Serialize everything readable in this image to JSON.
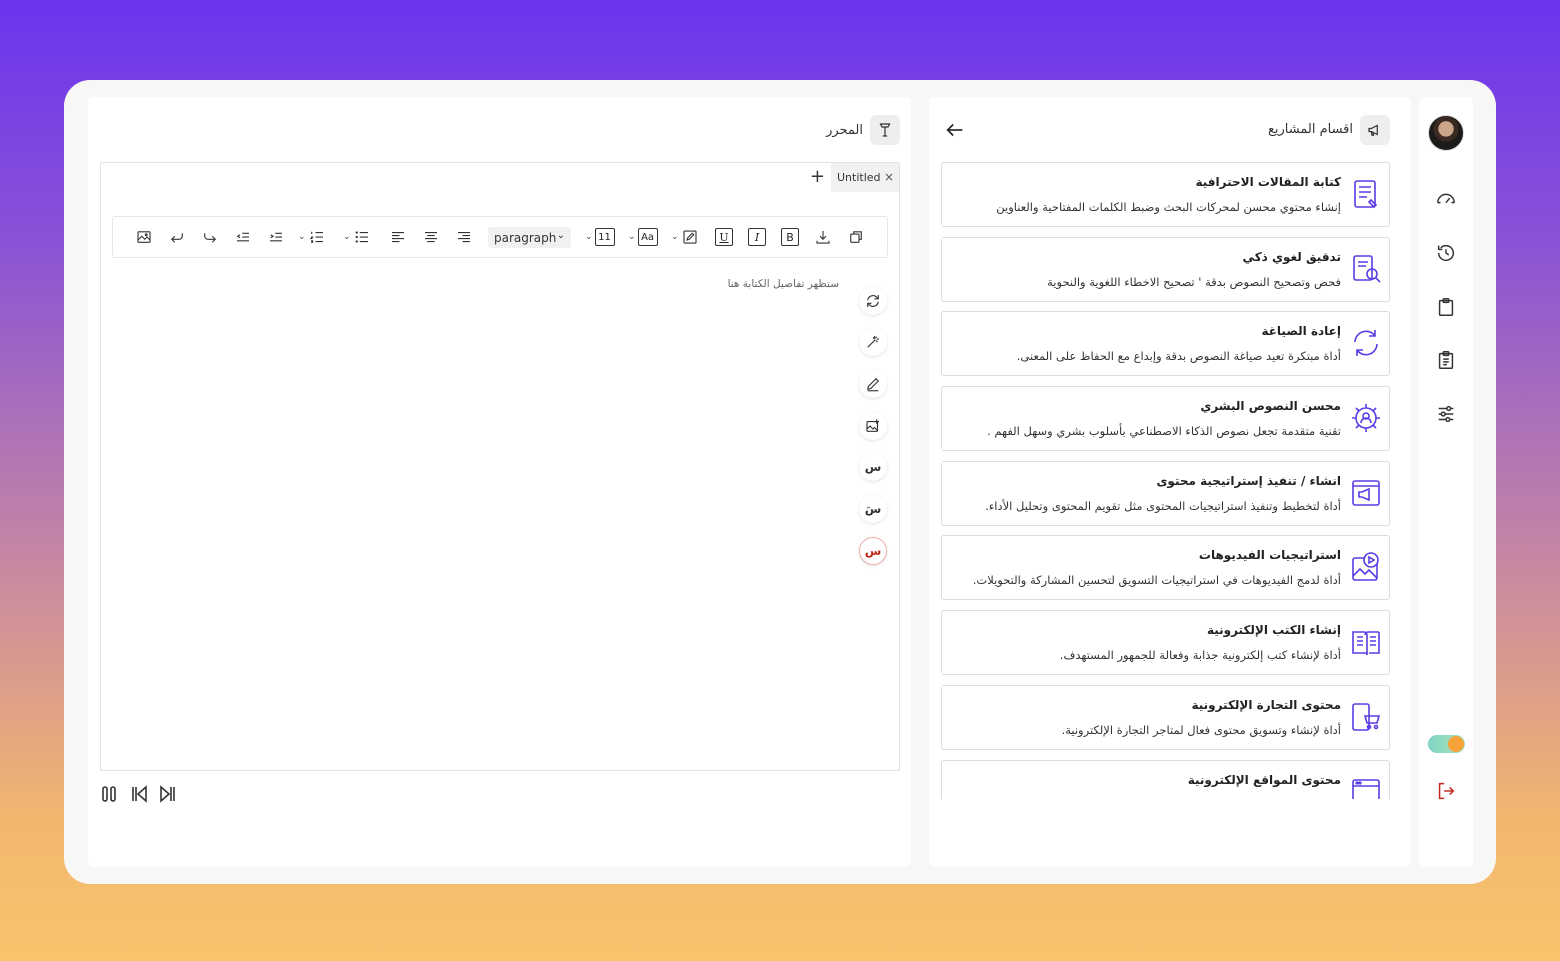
{
  "rail": {
    "icons": [
      "gauge-icon",
      "history-icon",
      "clipboard-icon",
      "clipboard-list-icon",
      "sliders-icon"
    ],
    "logout_icon": "logout-icon"
  },
  "projects": {
    "title": "اقسام المشاريع",
    "items": [
      {
        "title": "كتابة المقالات الاحترافية",
        "desc": "إنشاء محتوي محسن لمحركات البحث وضبط الكلمات المفتاحية والعناوين",
        "icon": "article-icon"
      },
      {
        "title": "تدقيق لغوي ذكي",
        "desc": "فحص وتصحيح النصوص بدقة ' تصحيح الاخطاء اللغوية والنحوية",
        "icon": "doc-search-icon"
      },
      {
        "title": "إعادة الصياغة",
        "desc": "أداة مبتكرة تعيد صياغة النصوص بدقة وإبداع مع الحفاظ على المعنى.",
        "icon": "refresh-icon"
      },
      {
        "title": "محسن النصوص البشري",
        "desc": "تقنية متقدمة تجعل نصوص الذكاء الاصطناعي بأسلوب بشري وسهل الفهم .",
        "icon": "user-gear-icon"
      },
      {
        "title": "انشاء / تنفيذ إستراتيجية محتوى",
        "desc": "أداة لتخطيط وتنفيذ استراتيجيات المحتوى مثل تقويم المحتوى وتحليل الأداء.",
        "icon": "megaphone-window-icon"
      },
      {
        "title": "استراتيجيات الفيديوهات",
        "desc": "أداة لدمج الفيديوهات في استراتيجيات التسويق لتحسين المشاركة والتحويلات.",
        "icon": "video-image-icon"
      },
      {
        "title": "إنشاء الكتب الإلكترونية",
        "desc": "أداة لإنشاء كتب إلكترونية جذابة وفعالة للجمهور المستهدف.",
        "icon": "book-icon"
      },
      {
        "title": "محتوى التجارة الإلكترونية",
        "desc": "أداة لإنشاء وتسويق محتوى فعال لمتاجر التجارة الإلكترونية.",
        "icon": "mobile-cart-icon"
      },
      {
        "title": "محتوى المواقع الإلكترونية",
        "desc": "",
        "icon": "browser-icon"
      }
    ]
  },
  "editor": {
    "title": "المحرر",
    "tab_label": "Untitled",
    "tab_close": "×",
    "tab_add": "+",
    "paragraph_select": "paragraph",
    "font_size": "11",
    "font_case": "Aa",
    "bold": "B",
    "italic": "I",
    "underline": "U",
    "placeholder": "ستظهر تفاصيل الكتابة هنا",
    "side_letters": [
      "س",
      "سَ",
      "س"
    ]
  }
}
